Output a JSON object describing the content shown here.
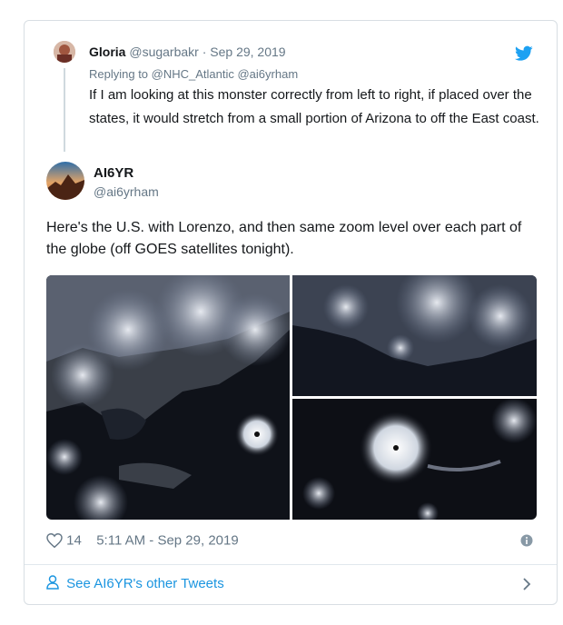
{
  "reply": {
    "name": "Gloria",
    "handle": "@sugarbakr",
    "separator": "·",
    "date": "Sep 29, 2019",
    "replying_to": "Replying to @NHC_Atlantic @ai6yrham",
    "text": "If I am looking at this monster correctly from left to right, if placed over the states, it would stretch from a small portion of Arizona to off the East coast."
  },
  "tweet": {
    "name": "AI6YR",
    "handle": "@ai6yrham",
    "text": "Here's the U.S. with Lorenzo, and then same zoom level over each part of the globe (off GOES satellites tonight).",
    "likes": "14",
    "timestamp": "5:11 AM - Sep 29, 2019"
  },
  "footer": {
    "see_more": "See AI6YR's other Tweets"
  },
  "colors": {
    "link": "#1b95e0",
    "muted": "#657786",
    "twitter_blue": "#1da1f2"
  },
  "icons": [
    "twitter-bird-icon",
    "heart-icon",
    "info-icon",
    "person-icon",
    "chevron-right-icon"
  ]
}
